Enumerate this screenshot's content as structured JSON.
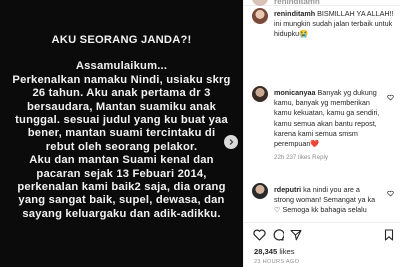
{
  "post": {
    "lines": [
      "AKU SEORANG JANDA?!",
      "",
      "Assamulaikum...",
      "Perkenalkan namaku Nindi, usiaku skrg",
      "26 tahun. Aku anak pertama dr 3",
      "bersaudara, Mantan suamiku anak",
      "tunggal. sesuai judul yang ku buat yaa",
      "bener, mantan suami tercintaku di",
      "rebut oleh seorang pelakor.",
      "Aku dan mantan Suami kenal dan",
      "pacaran sejak 13 Febuari 2014,",
      "perkenalan kami baik2 saja, dia orang",
      "yang sangat baik, supel, dewasa, dan",
      "sayang keluargaku dan adik-adikku."
    ]
  },
  "header": {
    "username": "reninditamh"
  },
  "comments": [
    {
      "username": "reninditamh",
      "lines": [
        "BISMILLAH YA ALLAH!!",
        "ini mungkin sudah jalan terbaik untuk",
        "hidupku😭"
      ],
      "meta": ""
    },
    {
      "username": "monicanyaa",
      "lines": [
        "Banyak yg dukung",
        "kamu, banyak yg memberikan",
        "kamu kekuatan, kamu ga sendiri,",
        "kamu semua akan bantu repost,",
        "karena kami semua smsm",
        "perempuan❤️"
      ],
      "meta": "22h   237 likes   Reply"
    },
    {
      "username": "rdeputri",
      "lines": [
        "ka nindi you are a",
        "strong woman! Semangat ya ka",
        "♡ Semoga kk bahagia selalu"
      ],
      "meta": ""
    }
  ],
  "likes": {
    "count": "28,345",
    "label": "likes"
  },
  "timestamp": "23 HOURS AGO",
  "colors": {
    "post_bg": "#0b0b0b",
    "heart": "#ed4956"
  }
}
